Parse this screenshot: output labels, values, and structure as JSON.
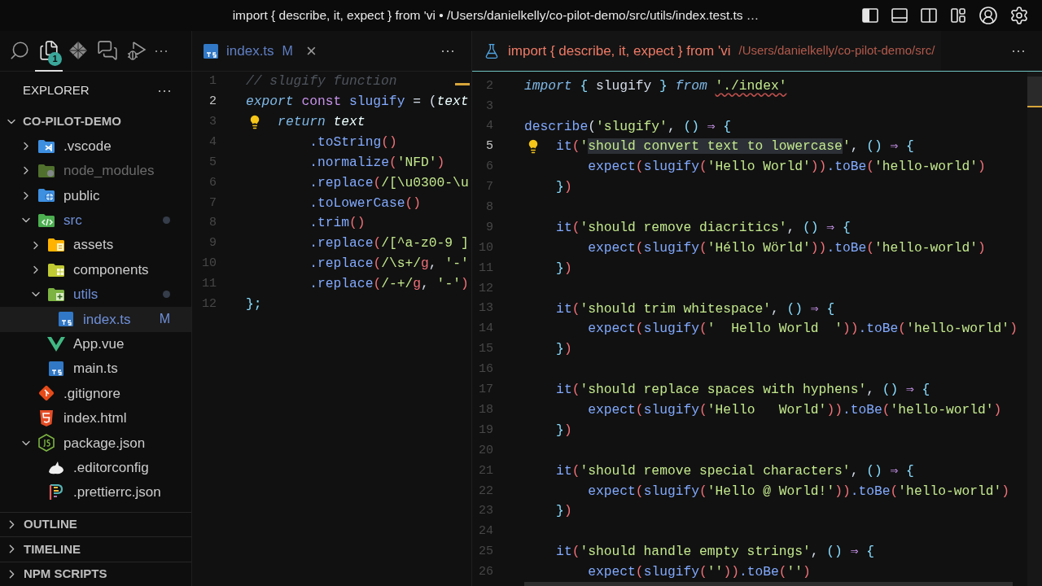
{
  "window": {
    "title": "import { describe, it, expect } from 'vi • /Users/danielkelly/co-pilot-demo/src/utils/index.test.ts …",
    "layout_toggles": [
      {
        "kind": "sidebar-left",
        "on": true
      },
      {
        "kind": "panel-bottom",
        "on": false
      },
      {
        "kind": "sidebar-right",
        "on": false
      }
    ],
    "actions": [
      {
        "kind": "layout"
      },
      {
        "kind": "account"
      },
      {
        "kind": "settings"
      }
    ]
  },
  "activity_bar": {
    "items": [
      {
        "kind": "search",
        "selected": false
      },
      {
        "kind": "explorer",
        "selected": true,
        "badge": "1"
      },
      {
        "kind": "diamond",
        "selected": false
      },
      {
        "kind": "chat",
        "selected": false
      },
      {
        "kind": "run",
        "selected": false
      }
    ],
    "more": "···"
  },
  "sidebar": {
    "title": "EXPLORER",
    "more": "···",
    "tree": {
      "label": "CO-PILOT-DEMO",
      "expanded": true,
      "children": [
        {
          "label": ".vscode",
          "kind": "vscode",
          "expanded": false
        },
        {
          "label": "node_modules",
          "kind": "node",
          "expanded": false,
          "ignored": true
        },
        {
          "label": "public",
          "kind": "public",
          "expanded": false
        },
        {
          "label": "src",
          "kind": "src",
          "expanded": true,
          "modified": true,
          "children": [
            {
              "label": "assets",
              "kind": "assets",
              "expanded": false
            },
            {
              "label": "components",
              "kind": "components",
              "expanded": false
            },
            {
              "label": "utils",
              "kind": "utils",
              "expanded": true,
              "modified": true,
              "children": [
                {
                  "label": "index.ts",
                  "kind": "ts",
                  "modified": true,
                  "badge": "M",
                  "selected": true
                }
              ]
            },
            {
              "label": "App.vue",
              "kind": "vue",
              "selected": false
            },
            {
              "label": "main.ts",
              "kind": "ts",
              "selected": false
            }
          ]
        },
        {
          "label": ".gitignore",
          "kind": "git",
          "selected": false
        },
        {
          "label": "index.html",
          "kind": "html",
          "selected": false
        },
        {
          "label": "package.json",
          "kind": "nodejson",
          "expanded": true,
          "children": [
            {
              "label": ".editorconfig",
              "kind": "editorconfig",
              "selected": false
            },
            {
              "label": ".prettierrc.json",
              "kind": "prettier",
              "selected": false
            }
          ]
        }
      ]
    },
    "sections": [
      {
        "label": "OUTLINE",
        "expanded": false
      },
      {
        "label": "TIMELINE",
        "expanded": false
      },
      {
        "label": "NPM SCRIPTS",
        "expanded": false
      }
    ]
  },
  "editors": [
    {
      "focused": false,
      "tab": {
        "label": "index.ts",
        "kind": "ts",
        "modified": true,
        "badge": "M",
        "close": "×"
      },
      "more": "···",
      "lines": [
        {
          "number": "1",
          "active": false,
          "kind": "code",
          "tokens": [
            {
              "text": "// slugify function",
              "kind": "cm"
            }
          ]
        },
        {
          "number": "2",
          "active": true,
          "kind": "code",
          "tokens": [
            {
              "text": "export",
              "kind": "kw"
            },
            {
              "text": " const",
              "kind": "st"
            },
            {
              "text": " slugify",
              "kind": "fn"
            },
            {
              "text": " = (",
              "kind": "pl"
            },
            {
              "text": "text",
              "kind": "var"
            }
          ]
        },
        {
          "number": "3",
          "active": false,
          "kind": "hint",
          "tokens": [
            {
              "text": "    return",
              "kind": "kw"
            },
            {
              "text": " text",
              "kind": "var"
            }
          ]
        },
        {
          "number": "4",
          "active": false,
          "kind": "code",
          "tokens": [
            {
              "text": "        .toString",
              "kind": "fn"
            },
            {
              "text": "()",
              "kind": "re"
            }
          ]
        },
        {
          "number": "5",
          "active": false,
          "kind": "code",
          "tokens": [
            {
              "text": "        .normalize",
              "kind": "fn"
            },
            {
              "text": "(",
              "kind": "re"
            },
            {
              "text": "'NFD'",
              "kind": "str"
            },
            {
              "text": ")",
              "kind": "re"
            }
          ]
        },
        {
          "number": "6",
          "active": false,
          "kind": "code",
          "tokens": [
            {
              "text": "        .replace",
              "kind": "fn"
            },
            {
              "text": "(",
              "kind": "re"
            },
            {
              "text": "/[\\u0300-\\u",
              "kind": "str"
            }
          ]
        },
        {
          "number": "7",
          "active": false,
          "kind": "code",
          "tokens": [
            {
              "text": "        .toLowerCase",
              "kind": "fn"
            },
            {
              "text": "()",
              "kind": "re"
            }
          ]
        },
        {
          "number": "8",
          "active": false,
          "kind": "code",
          "tokens": [
            {
              "text": "        .trim",
              "kind": "fn"
            },
            {
              "text": "()",
              "kind": "re"
            }
          ]
        },
        {
          "number": "9",
          "active": false,
          "kind": "code",
          "tokens": [
            {
              "text": "        .replace",
              "kind": "fn"
            },
            {
              "text": "(",
              "kind": "re"
            },
            {
              "text": "/[^a-z0-9 ]",
              "kind": "str"
            }
          ]
        },
        {
          "number": "10",
          "active": false,
          "kind": "code",
          "tokens": [
            {
              "text": "        .replace",
              "kind": "fn"
            },
            {
              "text": "(",
              "kind": "re"
            },
            {
              "text": "/\\s+/",
              "kind": "str"
            },
            {
              "text": "g",
              "kind": "re"
            },
            {
              "text": ", ",
              "kind": "pl"
            },
            {
              "text": "'-'",
              "kind": "str"
            }
          ]
        },
        {
          "number": "11",
          "active": false,
          "kind": "code",
          "tokens": [
            {
              "text": "        .replace",
              "kind": "fn"
            },
            {
              "text": "(",
              "kind": "re"
            },
            {
              "text": "/-+/",
              "kind": "str"
            },
            {
              "text": "g",
              "kind": "re"
            },
            {
              "text": ", ",
              "kind": "pl"
            },
            {
              "text": "'-'",
              "kind": "str"
            },
            {
              "text": ")",
              "kind": "re"
            }
          ]
        },
        {
          "number": "12",
          "active": false,
          "kind": "code",
          "tokens": [
            {
              "text": "};",
              "kind": "br"
            }
          ]
        }
      ]
    },
    {
      "focused": true,
      "tab": {
        "label": "import { describe, it, expect } from 'vi",
        "kind": "test",
        "errors": true,
        "description": "/Users/danielkelly/co-pilot-demo/src/"
      },
      "more": "···",
      "lines": [
        {
          "number": "2",
          "active": false,
          "kind": "code",
          "tokens": [
            {
              "text": "import",
              "kind": "kw"
            },
            {
              "text": " {",
              "kind": "br"
            },
            {
              "text": " slugify ",
              "kind": "pl"
            },
            {
              "text": "}",
              "kind": "br"
            },
            {
              "text": " from ",
              "kind": "kw"
            },
            {
              "text": "'./index'",
              "kind": "err"
            }
          ]
        },
        {
          "number": "3",
          "active": false,
          "kind": "code"
        },
        {
          "number": "4",
          "active": false,
          "kind": "code",
          "tokens": [
            {
              "text": "describe",
              "kind": "fn"
            },
            {
              "text": "(",
              "kind": "pl"
            },
            {
              "text": "'slugify'",
              "kind": "str"
            },
            {
              "text": ", ",
              "kind": "pl"
            },
            {
              "text": "()",
              "kind": "br"
            },
            {
              "text": " ⇒",
              "kind": "st"
            },
            {
              "text": " {",
              "kind": "br"
            }
          ]
        },
        {
          "number": "5",
          "active": true,
          "kind": "hint",
          "tokens": [
            {
              "text": "    it",
              "kind": "fn"
            },
            {
              "text": "(",
              "kind": "re"
            },
            {
              "text": "'",
              "kind": "str"
            },
            {
              "text": "should convert text to lowercase",
              "kind": "sel"
            },
            {
              "text": "'",
              "kind": "str"
            },
            {
              "text": ", ",
              "kind": "pl"
            },
            {
              "text": "()",
              "kind": "br"
            },
            {
              "text": " ⇒",
              "kind": "st"
            },
            {
              "text": " {",
              "kind": "br"
            }
          ]
        },
        {
          "number": "6",
          "active": false,
          "kind": "code",
          "tokens": [
            {
              "text": "        expect",
              "kind": "fn"
            },
            {
              "text": "(",
              "kind": "re"
            },
            {
              "text": "slugify",
              "kind": "fn"
            },
            {
              "text": "(",
              "kind": "re"
            },
            {
              "text": "'Hello World'",
              "kind": "str"
            },
            {
              "text": "))",
              "kind": "re"
            },
            {
              "text": ".toBe",
              "kind": "fn"
            },
            {
              "text": "(",
              "kind": "re"
            },
            {
              "text": "'hello-world'",
              "kind": "str"
            },
            {
              "text": ")",
              "kind": "re"
            }
          ]
        },
        {
          "number": "7",
          "active": false,
          "kind": "code",
          "tokens": [
            {
              "text": "    }",
              "kind": "br"
            },
            {
              "text": ")",
              "kind": "re"
            }
          ]
        },
        {
          "number": "8",
          "active": false,
          "kind": "code"
        },
        {
          "number": "9",
          "active": false,
          "kind": "code",
          "tokens": [
            {
              "text": "    it",
              "kind": "fn"
            },
            {
              "text": "(",
              "kind": "re"
            },
            {
              "text": "'should remove diacritics'",
              "kind": "str"
            },
            {
              "text": ", ",
              "kind": "pl"
            },
            {
              "text": "()",
              "kind": "br"
            },
            {
              "text": " ⇒",
              "kind": "st"
            },
            {
              "text": " {",
              "kind": "br"
            }
          ]
        },
        {
          "number": "10",
          "active": false,
          "kind": "code",
          "tokens": [
            {
              "text": "        expect",
              "kind": "fn"
            },
            {
              "text": "(",
              "kind": "re"
            },
            {
              "text": "slugify",
              "kind": "fn"
            },
            {
              "text": "(",
              "kind": "re"
            },
            {
              "text": "'Héllo Wörld'",
              "kind": "str"
            },
            {
              "text": "))",
              "kind": "re"
            },
            {
              "text": ".toBe",
              "kind": "fn"
            },
            {
              "text": "(",
              "kind": "re"
            },
            {
              "text": "'hello-world'",
              "kind": "str"
            },
            {
              "text": ")",
              "kind": "re"
            }
          ]
        },
        {
          "number": "11",
          "active": false,
          "kind": "code",
          "tokens": [
            {
              "text": "    }",
              "kind": "br"
            },
            {
              "text": ")",
              "kind": "re"
            }
          ]
        },
        {
          "number": "12",
          "active": false,
          "kind": "code"
        },
        {
          "number": "13",
          "active": false,
          "kind": "code",
          "tokens": [
            {
              "text": "    it",
              "kind": "fn"
            },
            {
              "text": "(",
              "kind": "re"
            },
            {
              "text": "'should trim whitespace'",
              "kind": "str"
            },
            {
              "text": ", ",
              "kind": "pl"
            },
            {
              "text": "()",
              "kind": "br"
            },
            {
              "text": " ⇒",
              "kind": "st"
            },
            {
              "text": " {",
              "kind": "br"
            }
          ]
        },
        {
          "number": "14",
          "active": false,
          "kind": "code",
          "tokens": [
            {
              "text": "        expect",
              "kind": "fn"
            },
            {
              "text": "(",
              "kind": "re"
            },
            {
              "text": "slugify",
              "kind": "fn"
            },
            {
              "text": "(",
              "kind": "re"
            },
            {
              "text": "'  Hello World  '",
              "kind": "str"
            },
            {
              "text": "))",
              "kind": "re"
            },
            {
              "text": ".toBe",
              "kind": "fn"
            },
            {
              "text": "(",
              "kind": "re"
            },
            {
              "text": "'hello-world'",
              "kind": "str"
            },
            {
              "text": ")",
              "kind": "re"
            }
          ]
        },
        {
          "number": "15",
          "active": false,
          "kind": "code",
          "tokens": [
            {
              "text": "    }",
              "kind": "br"
            },
            {
              "text": ")",
              "kind": "re"
            }
          ]
        },
        {
          "number": "16",
          "active": false,
          "kind": "code"
        },
        {
          "number": "17",
          "active": false,
          "kind": "code",
          "tokens": [
            {
              "text": "    it",
              "kind": "fn"
            },
            {
              "text": "(",
              "kind": "re"
            },
            {
              "text": "'should replace spaces with hyphens'",
              "kind": "str"
            },
            {
              "text": ", ",
              "kind": "pl"
            },
            {
              "text": "()",
              "kind": "br"
            },
            {
              "text": " ⇒",
              "kind": "st"
            },
            {
              "text": " {",
              "kind": "br"
            }
          ]
        },
        {
          "number": "18",
          "active": false,
          "kind": "code",
          "tokens": [
            {
              "text": "        expect",
              "kind": "fn"
            },
            {
              "text": "(",
              "kind": "re"
            },
            {
              "text": "slugify",
              "kind": "fn"
            },
            {
              "text": "(",
              "kind": "re"
            },
            {
              "text": "'Hello   World'",
              "kind": "str"
            },
            {
              "text": "))",
              "kind": "re"
            },
            {
              "text": ".toBe",
              "kind": "fn"
            },
            {
              "text": "(",
              "kind": "re"
            },
            {
              "text": "'hello-world'",
              "kind": "str"
            },
            {
              "text": ")",
              "kind": "re"
            }
          ]
        },
        {
          "number": "19",
          "active": false,
          "kind": "code",
          "tokens": [
            {
              "text": "    }",
              "kind": "br"
            },
            {
              "text": ")",
              "kind": "re"
            }
          ]
        },
        {
          "number": "20",
          "active": false,
          "kind": "code"
        },
        {
          "number": "21",
          "active": false,
          "kind": "code",
          "tokens": [
            {
              "text": "    it",
              "kind": "fn"
            },
            {
              "text": "(",
              "kind": "re"
            },
            {
              "text": "'should remove special characters'",
              "kind": "str"
            },
            {
              "text": ", ",
              "kind": "pl"
            },
            {
              "text": "()",
              "kind": "br"
            },
            {
              "text": " ⇒",
              "kind": "st"
            },
            {
              "text": " {",
              "kind": "br"
            }
          ]
        },
        {
          "number": "22",
          "active": false,
          "kind": "code",
          "tokens": [
            {
              "text": "        expect",
              "kind": "fn"
            },
            {
              "text": "(",
              "kind": "re"
            },
            {
              "text": "slugify",
              "kind": "fn"
            },
            {
              "text": "(",
              "kind": "re"
            },
            {
              "text": "'Hello @ World!'",
              "kind": "str"
            },
            {
              "text": "))",
              "kind": "re"
            },
            {
              "text": ".toBe",
              "kind": "fn"
            },
            {
              "text": "(",
              "kind": "re"
            },
            {
              "text": "'hello-world'",
              "kind": "str"
            },
            {
              "text": ")",
              "kind": "re"
            }
          ]
        },
        {
          "number": "23",
          "active": false,
          "kind": "code",
          "tokens": [
            {
              "text": "    }",
              "kind": "br"
            },
            {
              "text": ")",
              "kind": "re"
            }
          ]
        },
        {
          "number": "24",
          "active": false,
          "kind": "code"
        },
        {
          "number": "25",
          "active": false,
          "kind": "code",
          "tokens": [
            {
              "text": "    it",
              "kind": "fn"
            },
            {
              "text": "(",
              "kind": "re"
            },
            {
              "text": "'should handle empty strings'",
              "kind": "str"
            },
            {
              "text": ", ",
              "kind": "pl"
            },
            {
              "text": "()",
              "kind": "br"
            },
            {
              "text": " ⇒",
              "kind": "st"
            },
            {
              "text": " {",
              "kind": "br"
            }
          ]
        },
        {
          "number": "26",
          "active": false,
          "kind": "code",
          "tokens": [
            {
              "text": "        expect",
              "kind": "fn"
            },
            {
              "text": "(",
              "kind": "re"
            },
            {
              "text": "slugify",
              "kind": "fn"
            },
            {
              "text": "(",
              "kind": "re"
            },
            {
              "text": "''",
              "kind": "str"
            },
            {
              "text": "))",
              "kind": "re"
            },
            {
              "text": ".toBe",
              "kind": "fn"
            },
            {
              "text": "(",
              "kind": "re"
            },
            {
              "text": "''",
              "kind": "str"
            },
            {
              "text": ")",
              "kind": "re"
            }
          ]
        }
      ]
    }
  ]
}
